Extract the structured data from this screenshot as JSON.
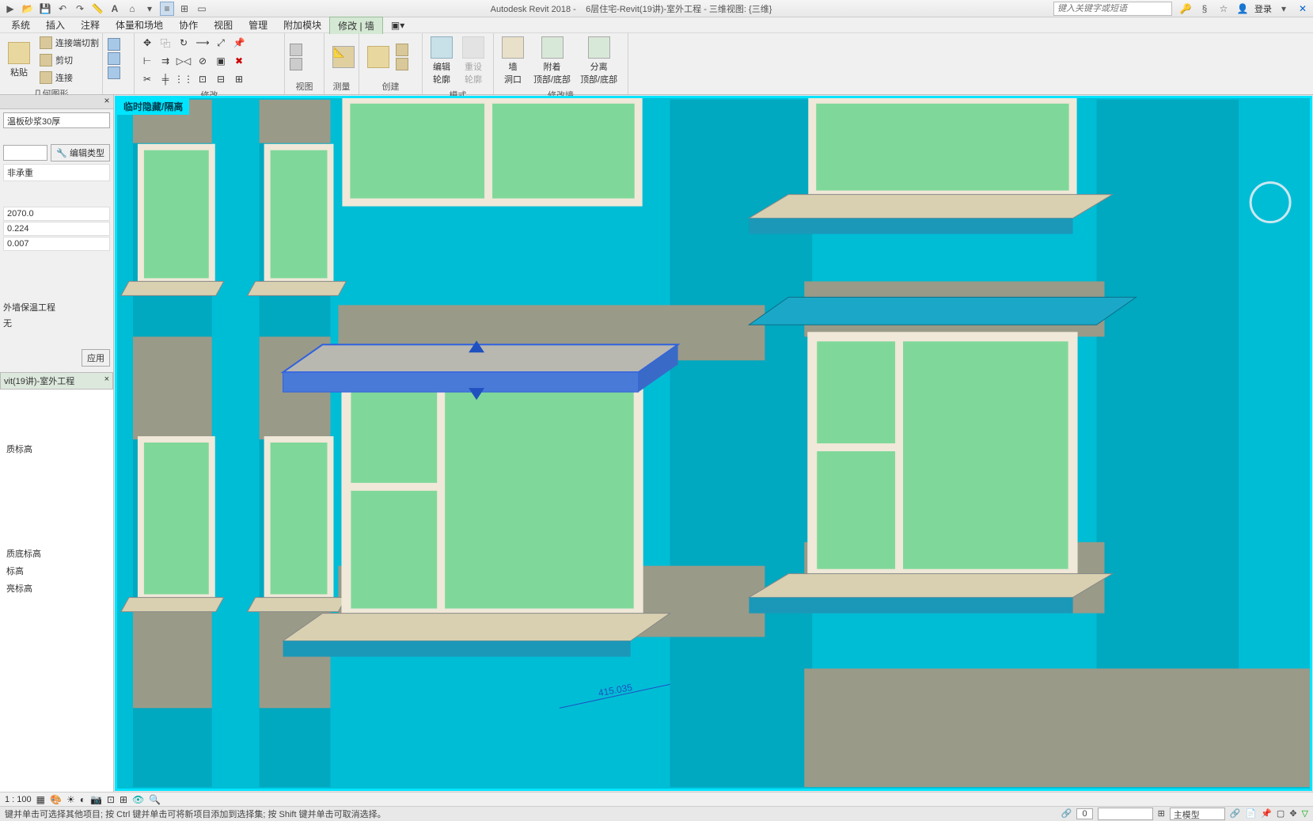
{
  "titlebar": {
    "app": "Autodesk Revit 2018 -",
    "doc": "6层住宅-Revit(19讲)-室外工程 - 三维视图: {三维}",
    "search_placeholder": "键入关键字或短语",
    "login": "登录"
  },
  "menubar": {
    "items": [
      "系统",
      "插入",
      "注释",
      "体量和场地",
      "协作",
      "视图",
      "管理",
      "附加模块",
      "修改 | 墙"
    ]
  },
  "ribbon": {
    "clipboard": {
      "label": "粘贴",
      "paste": "粘贴",
      "cut": "剪切",
      "join": "连接",
      "match": "连接端切割"
    },
    "geom": {
      "label": "几何图形"
    },
    "modify": {
      "label": "修改"
    },
    "view": {
      "label": "视图"
    },
    "measure": {
      "label": "测量"
    },
    "create": {
      "label": "创建"
    },
    "mode": {
      "label": "模式",
      "edit": "编辑\n轮廓",
      "reset": "重设\n轮廓"
    },
    "wall": {
      "label": "修改墙",
      "opening": "墙\n洞口",
      "attach": "附着\n顶部/底部",
      "detach": "分离\n顶部/底部"
    }
  },
  "properties": {
    "type": "温板砂浆30厚",
    "edit_type": "编辑类型",
    "structural": "非承重",
    "vals": [
      "2070.0",
      "0.224",
      "0.007"
    ],
    "cat": "外墙保温工程",
    "none": "无",
    "apply": "应用"
  },
  "browser": {
    "title": "vit(19讲)-室外工程",
    "nodes": [
      "质标高",
      "质底标高",
      "标高",
      "亮标高"
    ]
  },
  "viewport": {
    "tag": "临时隐藏/隔离",
    "dim": "415.035"
  },
  "vcb": {
    "scale": "1 : 100"
  },
  "statusbar": {
    "msg": "键并单击可选择其他项目; 按 Ctrl 键并单击可将新项目添加到选择集; 按 Shift 键并单击可取消选择。",
    "zero": "0",
    "model": "主模型"
  }
}
